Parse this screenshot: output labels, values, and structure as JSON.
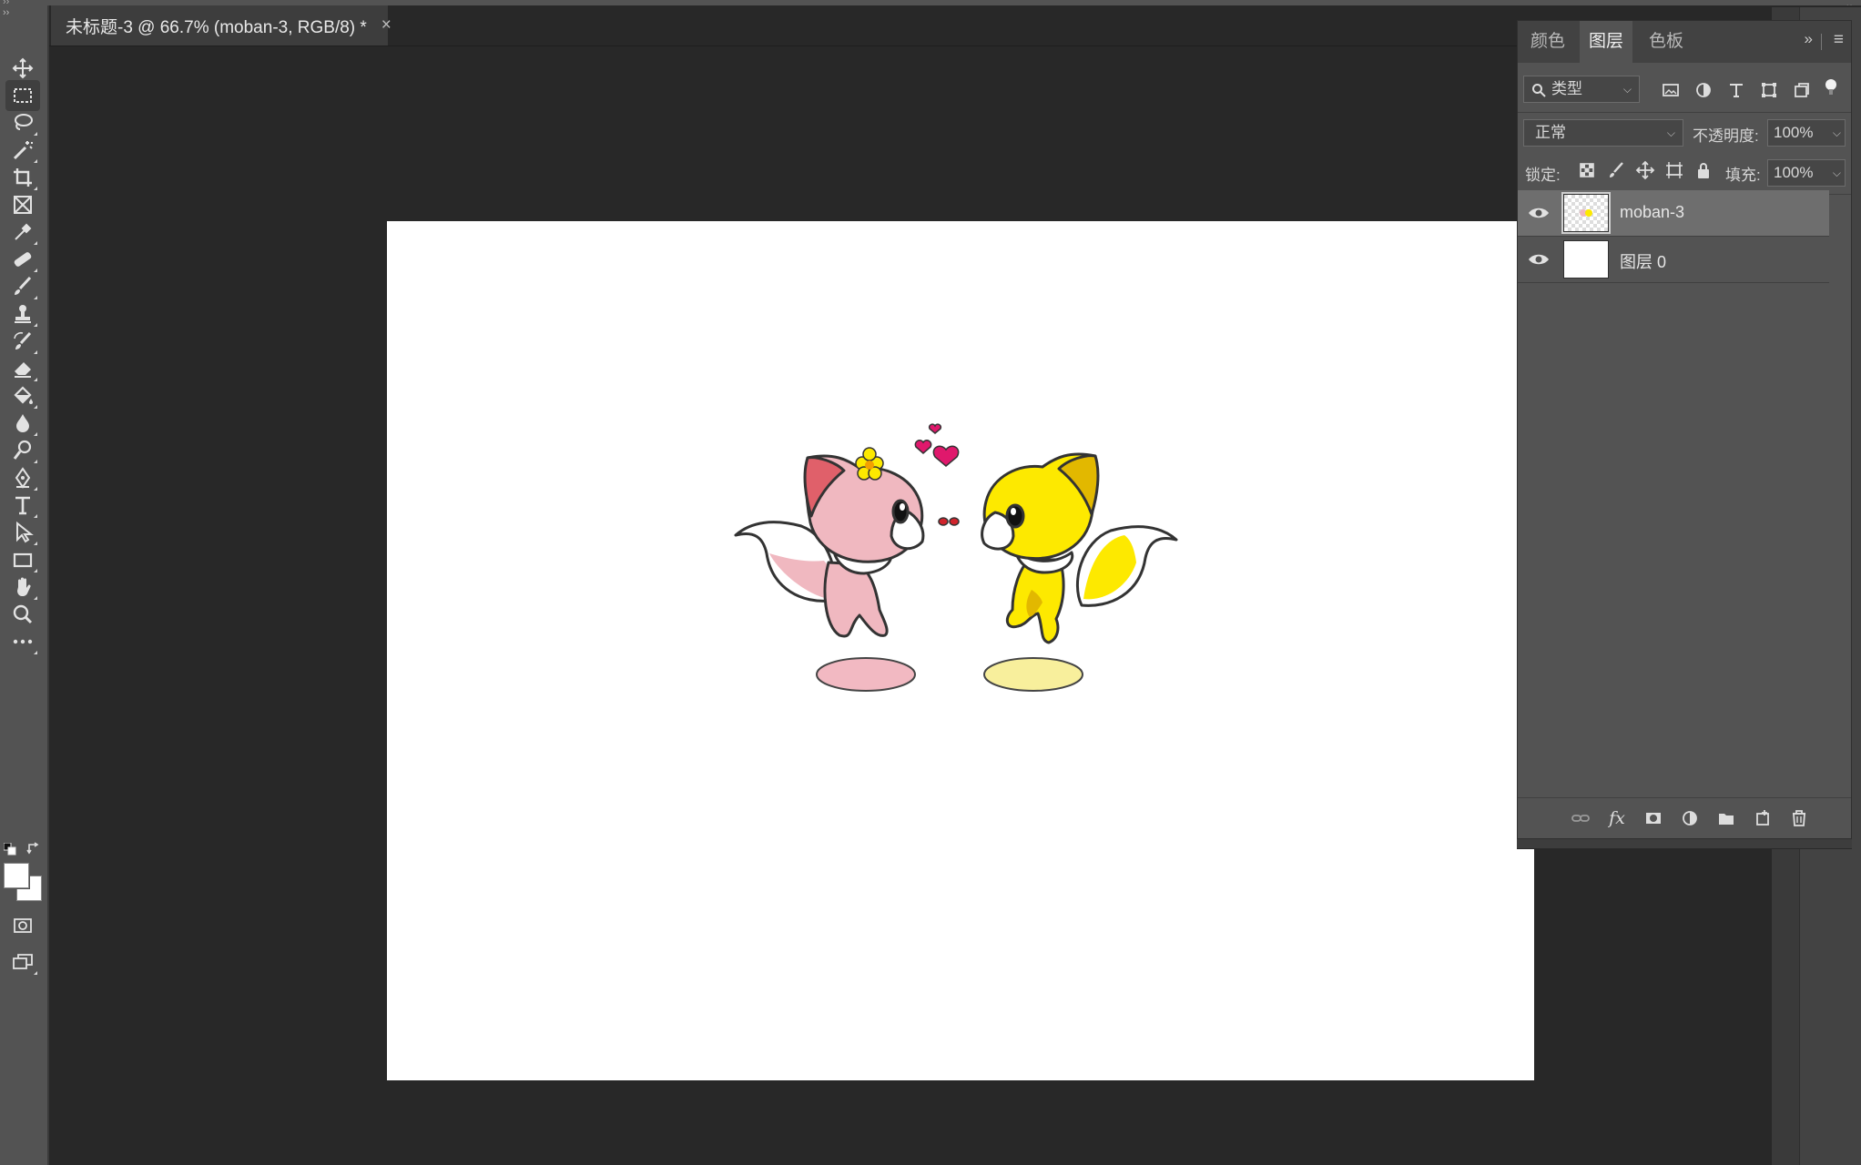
{
  "window": {
    "collapse_left_glyph": "››",
    "collapse_right_glyph": "‹‹"
  },
  "toolbar": {
    "header_glyph": "››",
    "tools": [
      {
        "name": "move-tool",
        "icon": "move-icon"
      },
      {
        "name": "rectangular-marquee-tool",
        "icon": "marquee-icon",
        "active": true
      },
      {
        "name": "lasso-tool",
        "icon": "lasso-icon"
      },
      {
        "name": "magic-wand-tool",
        "icon": "magic-wand-icon"
      },
      {
        "name": "crop-tool",
        "icon": "crop-icon"
      },
      {
        "name": "frame-tool",
        "icon": "frame-icon"
      },
      {
        "name": "eyedropper-tool",
        "icon": "eyedropper-icon"
      },
      {
        "name": "healing-brush-tool",
        "icon": "bandage-icon"
      },
      {
        "name": "brush-tool",
        "icon": "brush-icon"
      },
      {
        "name": "clone-stamp-tool",
        "icon": "stamp-icon"
      },
      {
        "name": "history-brush-tool",
        "icon": "history-brush-icon"
      },
      {
        "name": "eraser-tool",
        "icon": "eraser-icon"
      },
      {
        "name": "paint-bucket-tool",
        "icon": "paint-bucket-icon"
      },
      {
        "name": "blur-tool",
        "icon": "blur-drop-icon"
      },
      {
        "name": "dodge-tool",
        "icon": "dodge-icon"
      },
      {
        "name": "pen-tool",
        "icon": "pen-icon"
      },
      {
        "name": "type-tool",
        "icon": "type-icon"
      },
      {
        "name": "path-selection-tool",
        "icon": "arrow-cursor-icon"
      },
      {
        "name": "rectangle-tool",
        "icon": "rectangle-icon"
      },
      {
        "name": "hand-tool",
        "icon": "hand-icon"
      },
      {
        "name": "zoom-tool",
        "icon": "zoom-icon"
      },
      {
        "name": "edit-toolbar",
        "icon": "more-dots-icon"
      }
    ],
    "foreground_color": "#ffffff",
    "background_color": "#ffffff"
  },
  "document": {
    "tab_title": "未标题-3 @ 66.7% (moban-3, RGB/8) *",
    "close_glyph": "×"
  },
  "layers_panel": {
    "tabs": [
      {
        "label": "颜色",
        "active": false
      },
      {
        "label": "图层",
        "active": true
      },
      {
        "label": "色板",
        "active": false
      }
    ],
    "more_glyph": "»",
    "filter": {
      "label": "类型"
    },
    "blend_mode": "正常",
    "opacity_label": "不透明度:",
    "opacity_value": "100%",
    "lock_label": "锁定:",
    "fill_label": "填充:",
    "fill_value": "100%",
    "layers": [
      {
        "name": "moban-3",
        "visible": true,
        "selected": true
      },
      {
        "name": "图层 0",
        "visible": true,
        "selected": false
      }
    ],
    "footer_fx_label": "fx"
  },
  "colors": {
    "pink_fox": "#f0b8c0",
    "pink_ear": "#e0606a",
    "yellow_fox": "#fde900",
    "yellow_shadow": "#e2b800",
    "heart": "#e0186c",
    "pink_oval": "#f2b9c2",
    "yellow_oval": "#f8ef9c"
  }
}
